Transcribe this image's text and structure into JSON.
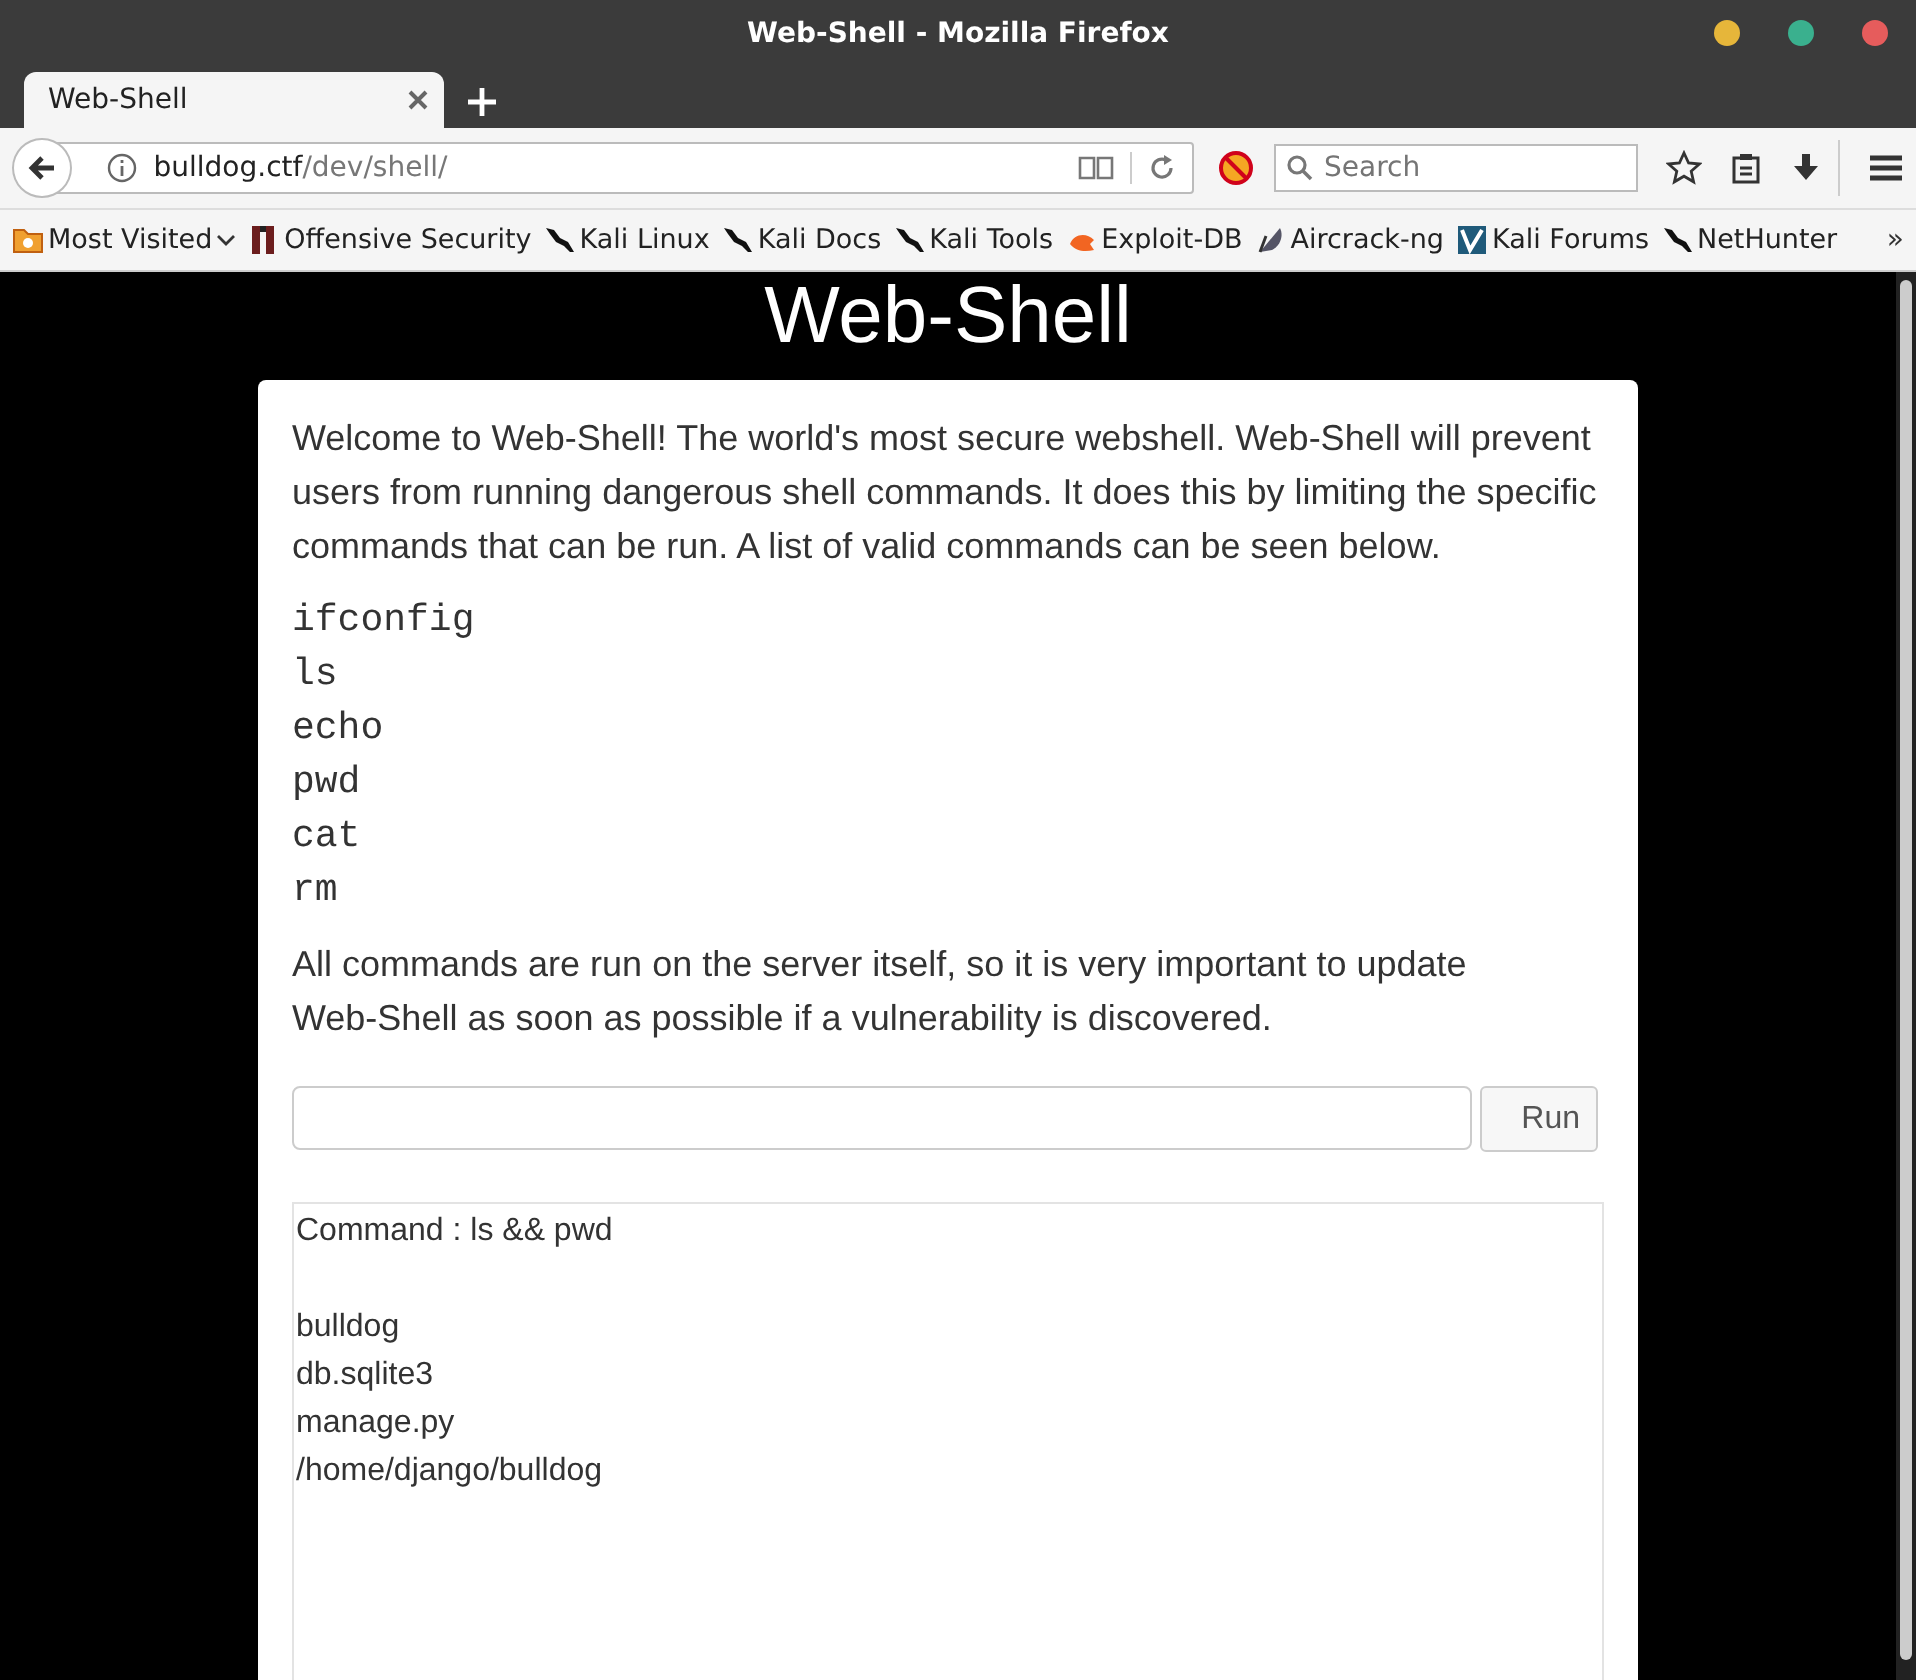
{
  "window": {
    "title": "Web-Shell - Mozilla Firefox"
  },
  "tabs": [
    {
      "label": "Web-Shell",
      "selected": true
    }
  ],
  "address_bar": {
    "host": "bulldog.ctf",
    "path": "/dev/shell/"
  },
  "search": {
    "placeholder": "Search"
  },
  "bookmarks": [
    {
      "label": "Most Visited",
      "kind": "folder"
    },
    {
      "label": "Offensive Security",
      "kind": "link"
    },
    {
      "label": "Kali Linux",
      "kind": "link"
    },
    {
      "label": "Kali Docs",
      "kind": "link"
    },
    {
      "label": "Kali Tools",
      "kind": "link"
    },
    {
      "label": "Exploit-DB",
      "kind": "link"
    },
    {
      "label": "Aircrack-ng",
      "kind": "link"
    },
    {
      "label": "Kali Forums",
      "kind": "link"
    },
    {
      "label": "NetHunter",
      "kind": "link"
    }
  ],
  "overflow": "»",
  "page": {
    "heading": "Web-Shell",
    "intro": "Welcome to Web-Shell! The world's most secure webshell. Web-Shell will prevent users from running dangerous shell commands. It does this by limiting the specific commands that can be run. A list of valid commands can be seen below.",
    "commands": [
      "ifconfig",
      "ls",
      "echo",
      "pwd",
      "cat",
      "rm"
    ],
    "note": "All commands are run on the server itself, so it is very important to update Web-Shell as soon as possible if a vulnerability is discovered.",
    "run_button": "Run",
    "output": {
      "command": "Command : ls && pwd",
      "lines": [
        "bulldog",
        "db.sqlite3",
        "manage.py",
        "/home/django/bulldog"
      ]
    }
  }
}
